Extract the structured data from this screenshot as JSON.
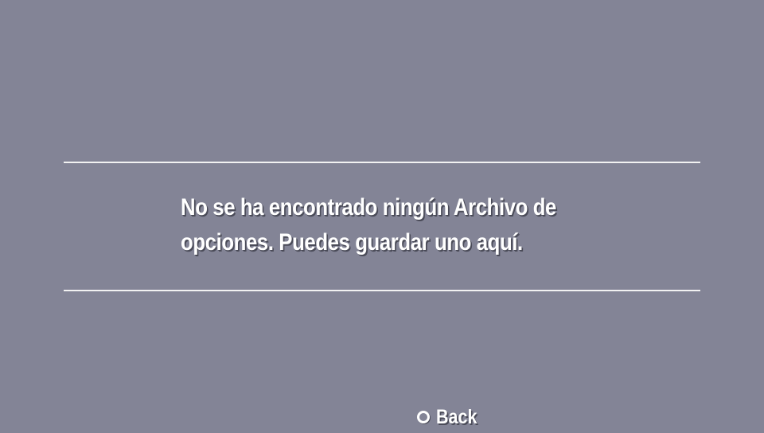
{
  "dialog": {
    "message_lines": [
      "No se ha encontrado ningún Archivo de",
      "opciones. Puedes guardar uno aquí."
    ]
  },
  "footer": {
    "back_icon": "circle-button-icon",
    "back_label": "Back"
  },
  "colors": {
    "background": "#838496",
    "text": "#ffffff",
    "rule": "#f2f2f2"
  }
}
